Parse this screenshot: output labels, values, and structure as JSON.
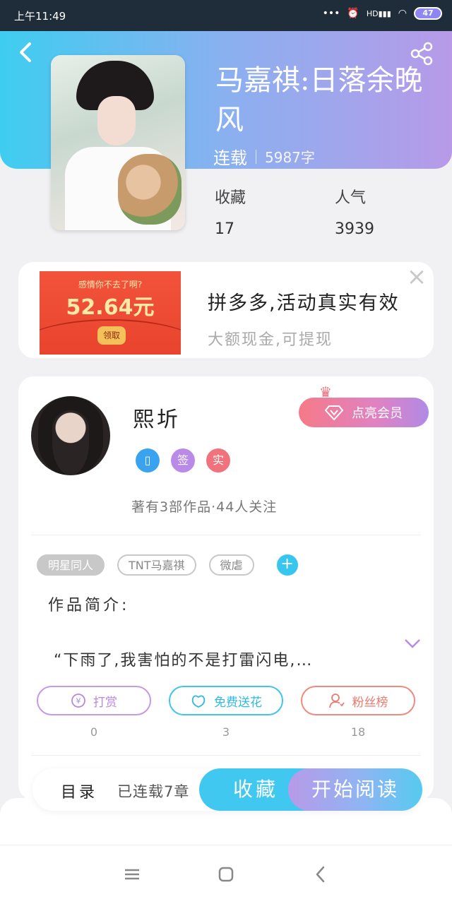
{
  "status_bar": {
    "time": "上午11:49",
    "signal_label": "HD",
    "battery": "47"
  },
  "book": {
    "title": "马嘉祺:日落余晚风",
    "status": "连载",
    "word_count": "5987字",
    "stats": [
      {
        "label": "收藏",
        "value": "17"
      },
      {
        "label": "人气",
        "value": "3939"
      }
    ]
  },
  "ad": {
    "image_caption": "感情你不去了啊?",
    "image_amount": "52.64元",
    "image_button": "领取",
    "title": "拼多多,活动真实有效",
    "subtitle": "大额现金,可提现",
    "close_glyph": "×"
  },
  "author": {
    "name": "熙圻",
    "vip_button": "点亮会员",
    "badges": [
      {
        "label": "",
        "color": "#3aa3f0"
      },
      {
        "label": "签",
        "color": "#b98ae8"
      },
      {
        "label": "实",
        "color": "#f0727c"
      }
    ],
    "summary": "著有3部作品·44人关注"
  },
  "tags": [
    "明星同人",
    "TNT马嘉祺",
    "微虐"
  ],
  "tag_add": "+",
  "intro": {
    "title": "作品简介:",
    "text": "“下雨了,我害怕的不是打雷闪电,…"
  },
  "actions": [
    {
      "label": "打赏",
      "icon": "yen-icon",
      "count": "0",
      "color": "#c49ae8"
    },
    {
      "label": "免费送花",
      "icon": "flower-icon",
      "count": "3",
      "color": "#3fc5ee"
    },
    {
      "label": "粉丝榜",
      "icon": "fans-icon",
      "count": "18",
      "color": "#f08a80"
    }
  ],
  "bottom_bar": {
    "catalog": "目录",
    "chapters": "已连载7章",
    "favorite": "收藏",
    "start_reading": "开始阅读"
  },
  "colors": {
    "header_gradient_start": "#3ecdf0",
    "header_gradient_end": "#b79ae8",
    "accent_blue": "#40c8f0"
  }
}
